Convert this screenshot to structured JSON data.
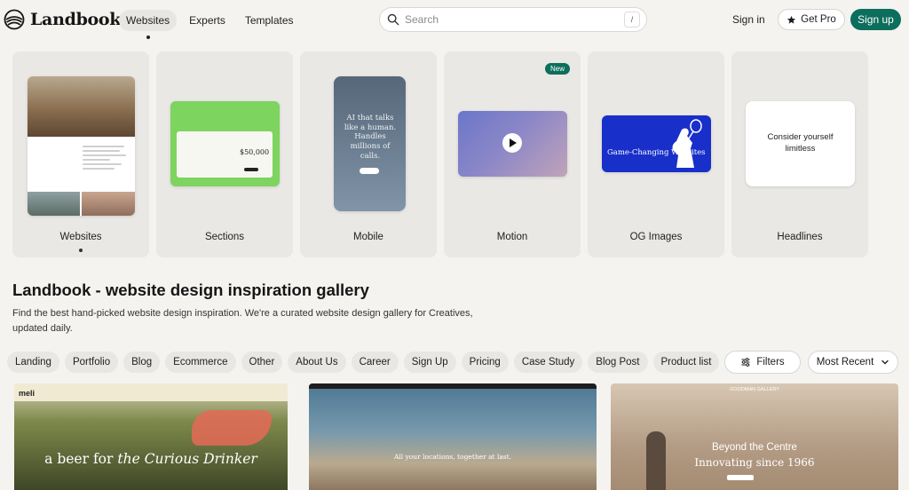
{
  "header": {
    "logo_text": "Landbook",
    "nav": [
      {
        "label": "Websites",
        "active": true
      },
      {
        "label": "Experts",
        "active": false
      },
      {
        "label": "Templates",
        "active": false
      }
    ],
    "search": {
      "placeholder": "Search",
      "shortcut": "/"
    },
    "signin_label": "Sign in",
    "getpro_label": "Get Pro",
    "signup_label": "Sign up",
    "accent_color": "#0c6e5c"
  },
  "categories": [
    {
      "label": "Websites",
      "active": true
    },
    {
      "label": "Sections",
      "active": false
    },
    {
      "label": "Mobile",
      "active": false
    },
    {
      "label": "Motion",
      "active": false,
      "badge": "New"
    },
    {
      "label": "OG Images",
      "active": false
    },
    {
      "label": "Headlines",
      "active": false
    }
  ],
  "thumbs": {
    "sections_amount": "$50,000",
    "mobile_text": "AI that talks like a human. Handles millions of calls.",
    "og_text": "Game-Changing Websites",
    "headlines_text": "Consider yourself limitless"
  },
  "main": {
    "title": "Landbook - website design inspiration gallery",
    "description": "Find the best hand-picked website design inspiration. We're a curated website design gallery for Creatives, updated daily."
  },
  "filters": {
    "chips": [
      "Landing",
      "Portfolio",
      "Blog",
      "Ecommerce",
      "Other",
      "About Us",
      "Career",
      "Sign Up",
      "Pricing",
      "Case Study",
      "Blog Post",
      "Product list"
    ],
    "filters_label": "Filters",
    "sort_label": "Most Recent"
  },
  "gallery": [
    {
      "brand": "meli",
      "headline_a": "a beer for ",
      "headline_b": "the Curious Drinker"
    },
    {
      "headline": "All your locations, together at last."
    },
    {
      "header": "GOODMAN GALLERY",
      "line1": "Beyond the Centre",
      "line2": "Innovating since 1966"
    }
  ]
}
